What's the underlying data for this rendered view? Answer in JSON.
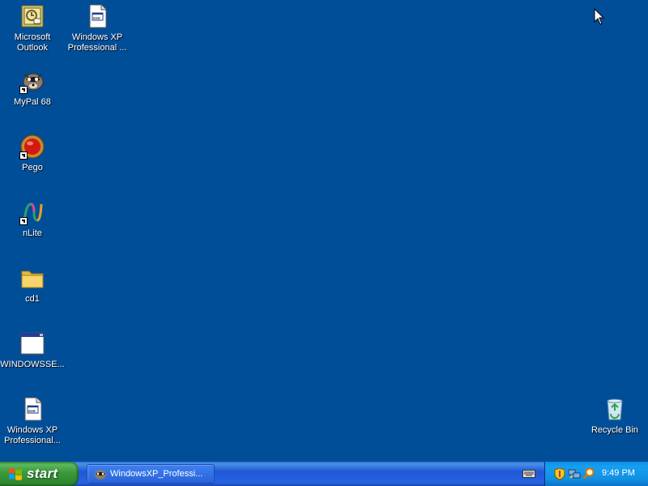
{
  "desktop": {
    "icons": [
      {
        "label": "Microsoft Outlook",
        "icon": "outlook-icon"
      },
      {
        "label": "Windows XP Professional ...",
        "icon": "setup-window-icon"
      },
      {
        "label": "MyPal 68",
        "icon": "mypal-raccoon-icon"
      },
      {
        "label": "Pego",
        "icon": "pego-red-orb-icon"
      },
      {
        "label": "nLite",
        "icon": "nlite-icon"
      },
      {
        "label": "cd1",
        "icon": "folder-icon"
      },
      {
        "label": "WINDOWSSE...",
        "icon": "window-icon"
      },
      {
        "label": "Windows XP Professional...",
        "icon": "setup-window-icon"
      },
      {
        "label": "Recycle Bin",
        "icon": "recycle-bin-icon"
      }
    ]
  },
  "taskbar": {
    "start_label": "start",
    "task_button_label": "WindowsXP_Professi...",
    "clock": "9:49 PM"
  },
  "colors": {
    "desktop_background": "#004e98",
    "taskbar_blue": "#2157d7",
    "start_green": "#3a9a3a",
    "tray_blue": "#1191e4"
  }
}
